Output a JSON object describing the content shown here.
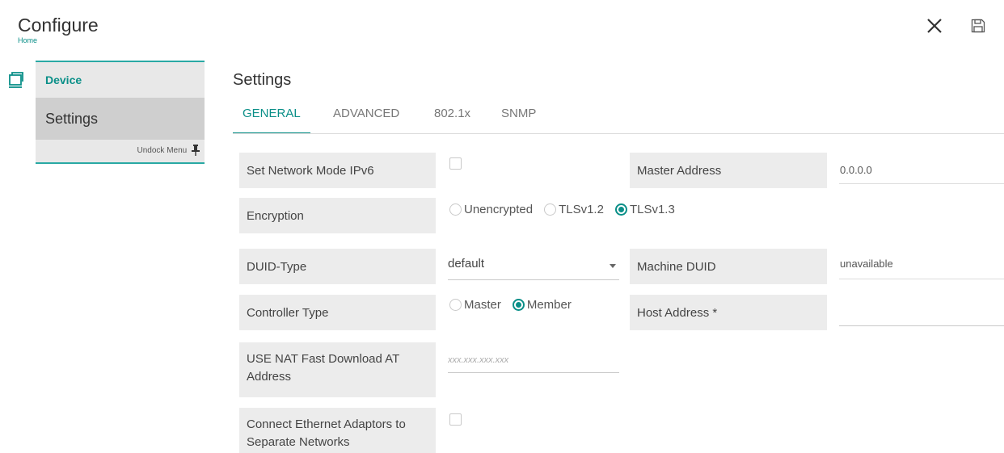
{
  "header": {
    "title": "Configure",
    "breadcrumb": "Home",
    "close_icon": "close-icon",
    "save_icon": "save-icon"
  },
  "sidebar": {
    "section_label": "Device",
    "section_icon": "device-icon",
    "active_item": "Settings",
    "undock_label": "Undock Menu",
    "accent_color": "#29a9a4"
  },
  "main": {
    "title": "Settings",
    "tabs": [
      {
        "label": "GENERAL",
        "active": true
      },
      {
        "label": "ADVANCED",
        "active": false
      },
      {
        "label": "802.1x",
        "active": false
      },
      {
        "label": "SNMP",
        "active": false
      }
    ]
  },
  "form": {
    "ipv6_label": "Set Network Mode IPv6",
    "ipv6_checked": false,
    "master_address_label": "Master Address",
    "master_address_value": "0.0.0.0",
    "encryption_label": "Encryption",
    "encryption_options": [
      "Unencrypted",
      "TLSv1.2",
      "TLSv1.3"
    ],
    "encryption_selected": "TLSv1.3",
    "duid_type_label": "DUID-Type",
    "duid_type_value": "default",
    "machine_duid_label": "Machine DUID",
    "machine_duid_value": "unavailable",
    "controller_type_label": "Controller Type",
    "controller_options": [
      "Master",
      "Member"
    ],
    "controller_selected": "Member",
    "host_address_label": "Host Address *",
    "host_address_value": "",
    "nat_label": "USE NAT Fast Download AT Address",
    "nat_placeholder": "xxx.xxx.xxx.xxx",
    "ethernet_label": "Connect Ethernet Adaptors to Separate Networks",
    "ethernet_checked": false
  },
  "colors": {
    "accent": "#0a8f88",
    "label_bg": "#ececec"
  }
}
